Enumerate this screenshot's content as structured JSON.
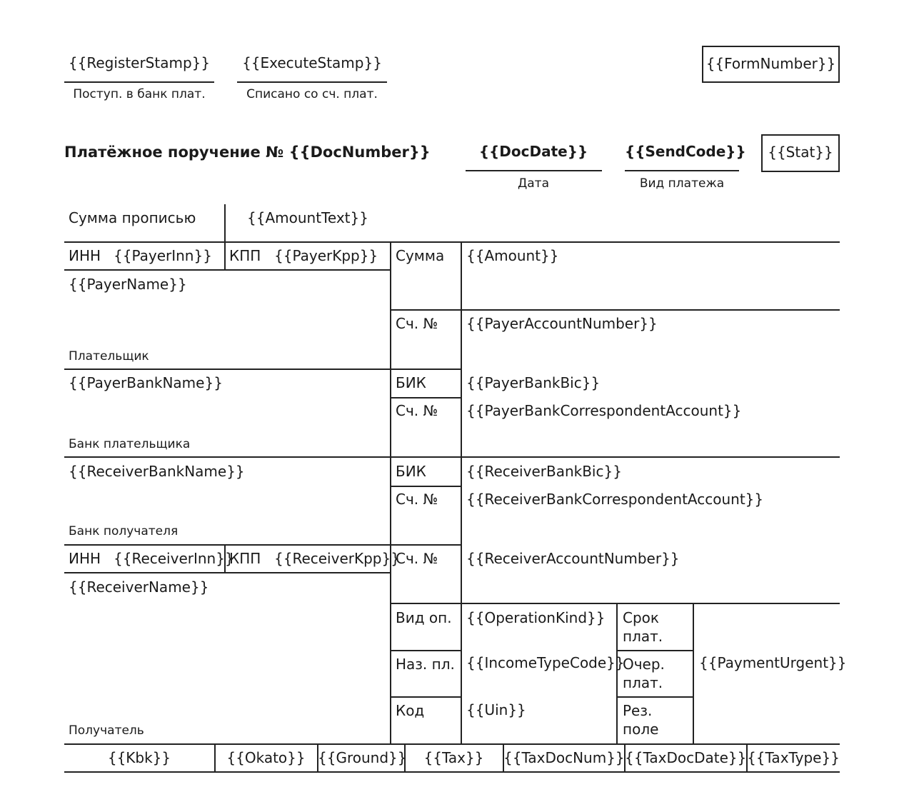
{
  "header": {
    "register_stamp": "{{RegisterStamp}}",
    "register_caption": "Поступ. в банк плат.",
    "execute_stamp": "{{ExecuteStamp}}",
    "execute_caption": "Списано со сч. плат.",
    "form_number": "{{FormNumber}}"
  },
  "title": {
    "text": "Платёжное поручение № {{DocNumber}}",
    "doc_date": "{{DocDate}}",
    "doc_date_caption": "Дата",
    "send_code": "{{SendCode}}",
    "send_code_caption": "Вид платежа",
    "stat": "{{Stat}}"
  },
  "amount_words": {
    "label": "Сумма прописью",
    "value": "{{AmountText}}"
  },
  "payer": {
    "inn_label": "ИНН",
    "inn": "{{PayerInn}}",
    "kpp_label": "КПП",
    "kpp": "{{PayerKpp}}",
    "name": "{{PayerName}}",
    "caption": "Плательщик",
    "sum_label": "Сумма",
    "sum": "{{Amount}}",
    "account_label": "Сч. №",
    "account": "{{PayerAccountNumber}}"
  },
  "payer_bank": {
    "name": "{{PayerBankName}}",
    "caption": "Банк плательщика",
    "bic_label": "БИК",
    "bic": "{{PayerBankBic}}",
    "corr_label": "Сч. №",
    "corr": "{{PayerBankCorrespondentAccount}}"
  },
  "receiver_bank": {
    "name": "{{ReceiverBankName}}",
    "caption": "Банк получателя",
    "bic_label": "БИК",
    "bic": "{{ReceiverBankBic}}",
    "corr_label": "Сч. №",
    "corr": "{{ReceiverBankCorrespondentAccount}}"
  },
  "receiver": {
    "inn_label": "ИНН",
    "inn": "{{ReceiverInn}}",
    "kpp_label": "КПП",
    "kpp": "{{ReceiverKpp}}",
    "account_label": "Сч. №",
    "account": "{{ReceiverAccountNumber}}",
    "name": "{{ReceiverName}}",
    "caption": "Получатель"
  },
  "operation": {
    "op_label": "Вид оп.",
    "op": "{{OperationKind}}",
    "purpose_label": "Наз. пл.",
    "income": "{{IncomeTypeCode}}",
    "code_label": "Код",
    "uin": "{{Uin}}",
    "term_label_1": "Срок",
    "term_label_2": "плат.",
    "order_label_1": "Очер.",
    "order_label_2": "плат.",
    "reserve_label_1": "Рез.",
    "reserve_label_2": "поле",
    "urgent": "{{PaymentUrgent}}"
  },
  "tax_row": {
    "kbk": "{{Kbk}}",
    "okato": "{{Okato}}",
    "ground": "{{Ground}}",
    "tax": "{{Tax}}",
    "tax_doc_num": "{{TaxDocNum}}",
    "tax_doc_date": "{{TaxDocDate}}",
    "tax_type": "{{TaxType}}"
  }
}
